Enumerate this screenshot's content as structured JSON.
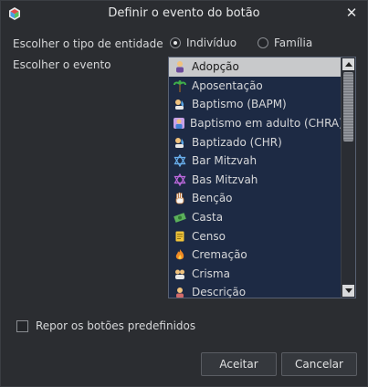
{
  "window": {
    "title": "Definir o evento do botão"
  },
  "entity": {
    "label": "Escolher o tipo de entidade",
    "options": [
      {
        "label": "Indivíduo",
        "selected": true
      },
      {
        "label": "Família",
        "selected": false
      }
    ]
  },
  "event": {
    "label": "Escolher o evento",
    "items": [
      {
        "label": "Adopção",
        "icon": "adoption-icon",
        "selected": true
      },
      {
        "label": "Aposentação",
        "icon": "palm-tree-icon"
      },
      {
        "label": "Baptismo (BAPM)",
        "icon": "baptism-icon"
      },
      {
        "label": "Baptismo em adulto (CHRA)",
        "icon": "adult-baptism-icon"
      },
      {
        "label": "Baptizado (CHR)",
        "icon": "baptism-icon"
      },
      {
        "label": "Bar Mitzvah",
        "icon": "star-of-david-icon"
      },
      {
        "label": "Bas Mitzvah",
        "icon": "star-of-david-icon"
      },
      {
        "label": "Benção",
        "icon": "hand-icon"
      },
      {
        "label": "Casta",
        "icon": "money-icon"
      },
      {
        "label": "Censo",
        "icon": "census-icon"
      },
      {
        "label": "Cremação",
        "icon": "fire-icon"
      },
      {
        "label": "Crisma",
        "icon": "confirmation-icon"
      },
      {
        "label": "Descrição",
        "icon": "description-icon"
      }
    ]
  },
  "reset_label": "Repor os botões predefinidos",
  "buttons": {
    "accept": "Aceitar",
    "cancel": "Cancelar"
  }
}
